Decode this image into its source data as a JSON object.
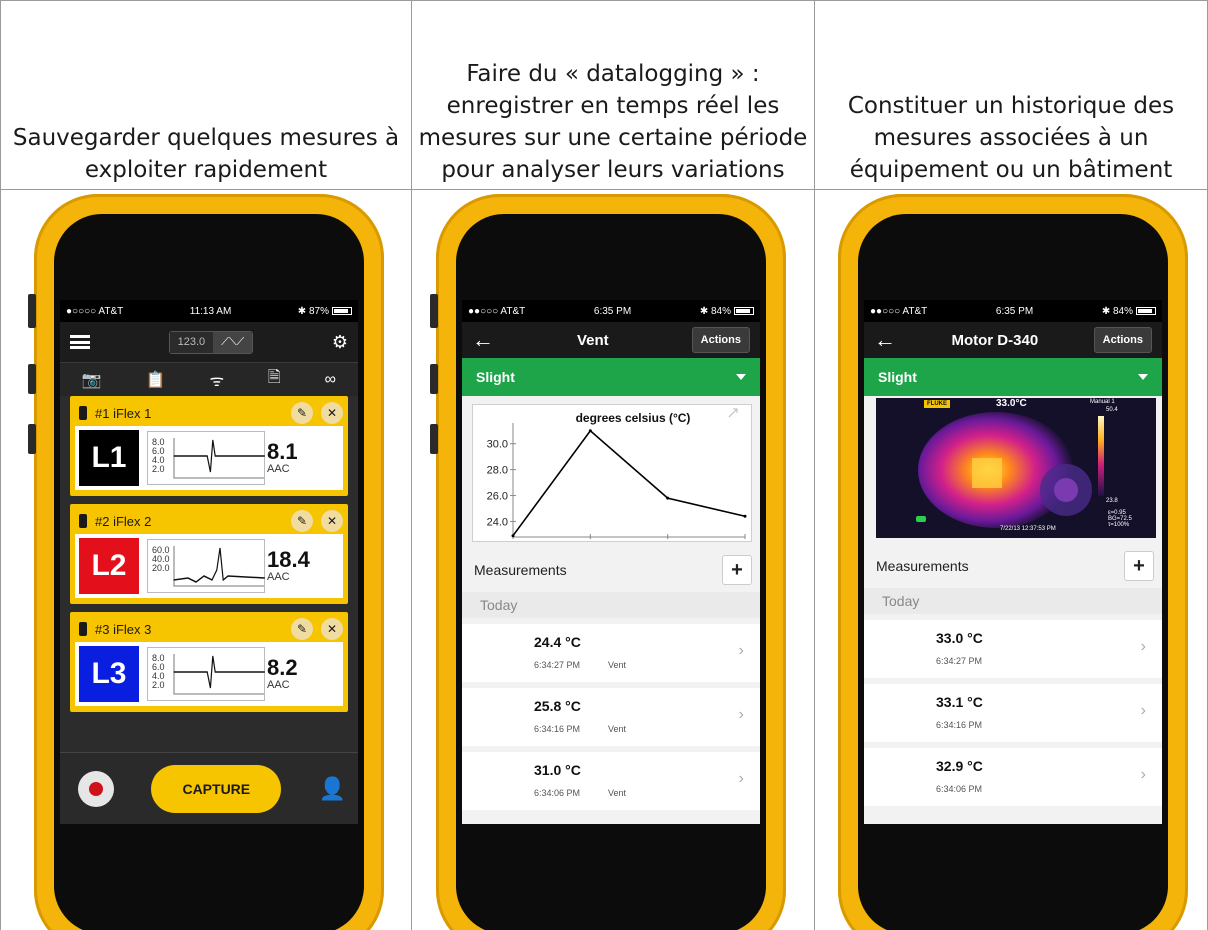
{
  "captions": [
    "Sauvegarder quelques mesures à exploiter rapidement",
    "Faire du « datalogging » : enregistrer en temps réel les mesures sur une certaine période pour analyser leurs variations",
    "Constituer un historique des mesures associées à un équipement ou un bâtiment"
  ],
  "phone1": {
    "status": {
      "carrier": "●○○○○ AT&T",
      "time": "11:13 AM",
      "battery": "87%"
    },
    "mode_value": "123.0",
    "cards": [
      {
        "name": "#1 iFlex 1",
        "tag": "L1",
        "tag_color": "#000000",
        "y_ticks": "8.0\n6.0\n4.0\n2.0",
        "value": "8.1",
        "unit": "AAC"
      },
      {
        "name": "#2 iFlex 2",
        "tag": "L2",
        "tag_color": "#e3101b",
        "y_ticks": "60.0\n40.0\n20.0",
        "value": "18.4",
        "unit": "AAC"
      },
      {
        "name": "#3 iFlex 3",
        "tag": "L3",
        "tag_color": "#0a1ee0",
        "y_ticks": "8.0\n6.0\n4.0\n2.0",
        "value": "8.2",
        "unit": "AAC"
      }
    ],
    "capture_label": "CAPTURE"
  },
  "phone2": {
    "status": {
      "carrier": "●●○○○ AT&T",
      "time": "6:35 PM",
      "battery": "84%"
    },
    "title": "Vent",
    "actions_label": "Actions",
    "filter": "Slight",
    "measurements_label": "Measurements",
    "today_label": "Today",
    "rows": [
      {
        "value": "24.4 °C",
        "time": "6:34:27 PM",
        "location": "Vent"
      },
      {
        "value": "25.8 °C",
        "time": "6:34:16 PM",
        "location": "Vent"
      },
      {
        "value": "31.0 °C",
        "time": "6:34:06 PM",
        "location": "Vent"
      }
    ]
  },
  "phone3": {
    "status": {
      "carrier": "●●○○○ AT&T",
      "time": "6:35 PM",
      "battery": "84%"
    },
    "title": "Motor D-340",
    "actions_label": "Actions",
    "filter": "Slight",
    "thermal": {
      "brand": "FLUKE",
      "temp": "33.0°C",
      "mode": "Manual 1",
      "scale_max": "50.4",
      "scale_min": "23.8",
      "stamp": "7/22/13  12:37:53 PM",
      "params": "ε=0.95\nBG=72.5\nτ=100%"
    },
    "measurements_label": "Measurements",
    "today_label": "Today",
    "rows": [
      {
        "value": "33.0 °C",
        "time": "6:34:27 PM"
      },
      {
        "value": "33.1 °C",
        "time": "6:34:16 PM"
      },
      {
        "value": "32.9 °C",
        "time": "6:34:06 PM"
      }
    ]
  },
  "chart_data": {
    "type": "line",
    "title": "degrees celsius (°C)",
    "y_ticks": [
      "30.0",
      "28.0",
      "26.0",
      "24.0"
    ],
    "ylim": [
      22.8,
      31.6
    ],
    "x": [
      0,
      1,
      2,
      3
    ],
    "series": [
      {
        "values": [
          22.9,
          31.0,
          25.8,
          24.4
        ]
      }
    ],
    "grid": false,
    "color": "#000000"
  }
}
